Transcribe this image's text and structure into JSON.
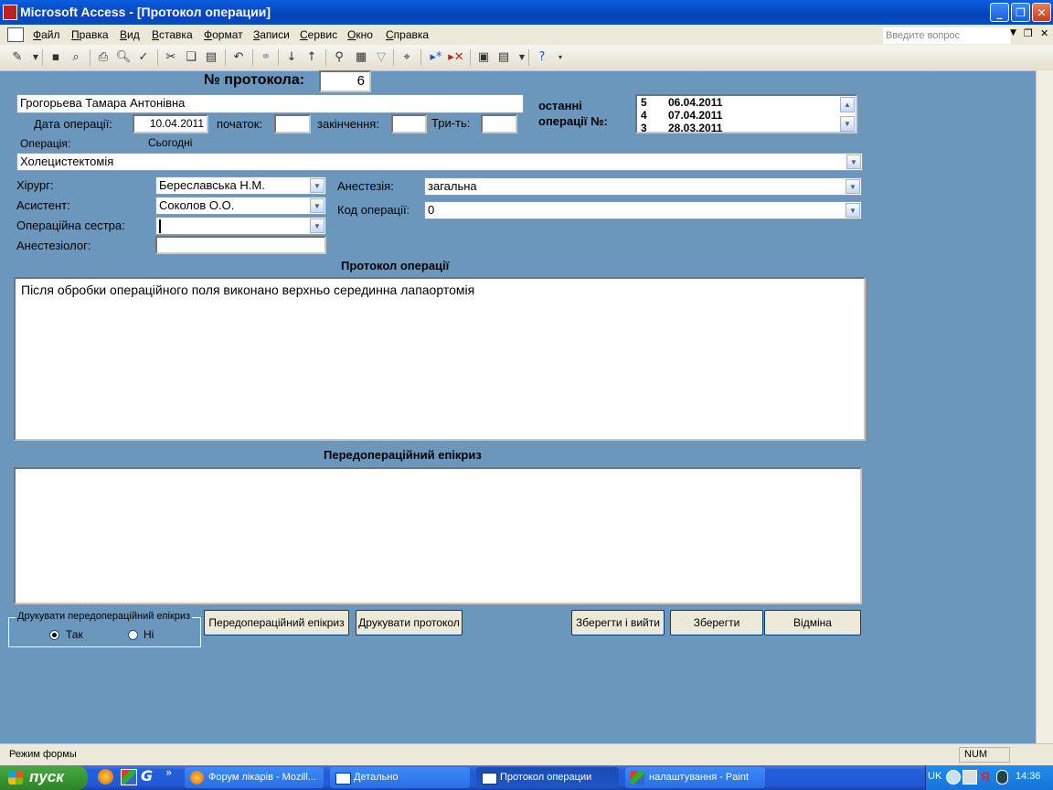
{
  "window": {
    "title": "Microsoft Access - [Протокол операции]",
    "minimize_glyph": "_",
    "restore_glyph": "❐",
    "close_glyph": "✕"
  },
  "menu": {
    "items": [
      "Файл",
      "Правка",
      "Вид",
      "Вставка",
      "Формат",
      "Записи",
      "Сервис",
      "Окно",
      "Справка"
    ],
    "help_placeholder": "Введите вопрос"
  },
  "form": {
    "protocol_label": "№ протокола:",
    "protocol_number": "6",
    "patient_name": "Грогорьева Тамара Антонівна",
    "last_ops_label_1": "останні",
    "last_ops_label_2": "операції №:",
    "last_ops": [
      {
        "n": "5",
        "date": "06.04.2011"
      },
      {
        "n": "4",
        "date": "07.04.2011"
      },
      {
        "n": "3",
        "date": "28.03.2011"
      }
    ],
    "date_label": "Дата операції:",
    "date_value": "10.04.2011",
    "start_label": "початок:",
    "start_value": "",
    "end_label": "закінчення:",
    "end_value": "",
    "duration_label": "Три-ть:",
    "duration_value": "",
    "operation_label": "Операція:",
    "today_label": "Сьогодні",
    "operation_value": "Холецистектомія",
    "surgeon_label": "Хірург:",
    "surgeon_value": "Береславська Н.М.",
    "assistant_label": "Асистент:",
    "assistant_value": "Соколов О.О.",
    "nurse_label": "Операційна сестра:",
    "nurse_value": "",
    "anesthesiologist_label": "Анестезіолог:",
    "anesthesiologist_value": "",
    "anesthesia_label": "Анестезія:",
    "anesthesia_value": "загальна",
    "opcode_label": "Код операції:",
    "opcode_value": "0",
    "protocol_section_title": "Протокол операції",
    "protocol_text": "Після обробки операційного поля виконано верхньо серединна лапаортомія",
    "epicrisis_section_title": "Передопераційний епікриз",
    "epicrisis_text": "",
    "print_group_label": "Друкувати передопераційний епікриз",
    "print_yes": "Так",
    "print_no": "Ні",
    "btn_epicrisis": "Передопераційний епікриз",
    "btn_print": "Друкувати протокол",
    "btn_save_exit": "Зберегти і вийти",
    "btn_save": "Зберегти",
    "btn_cancel": "Відміна"
  },
  "status": {
    "mode": "Режим формы",
    "num": "NUM"
  },
  "taskbar": {
    "start": "пуск",
    "tasks": [
      "Форум лікарів - Mozill...",
      "Детально",
      "Протокол операции",
      "налаштування - Paint"
    ],
    "lang": "UK",
    "time": "14:36",
    "overflow": "»"
  }
}
